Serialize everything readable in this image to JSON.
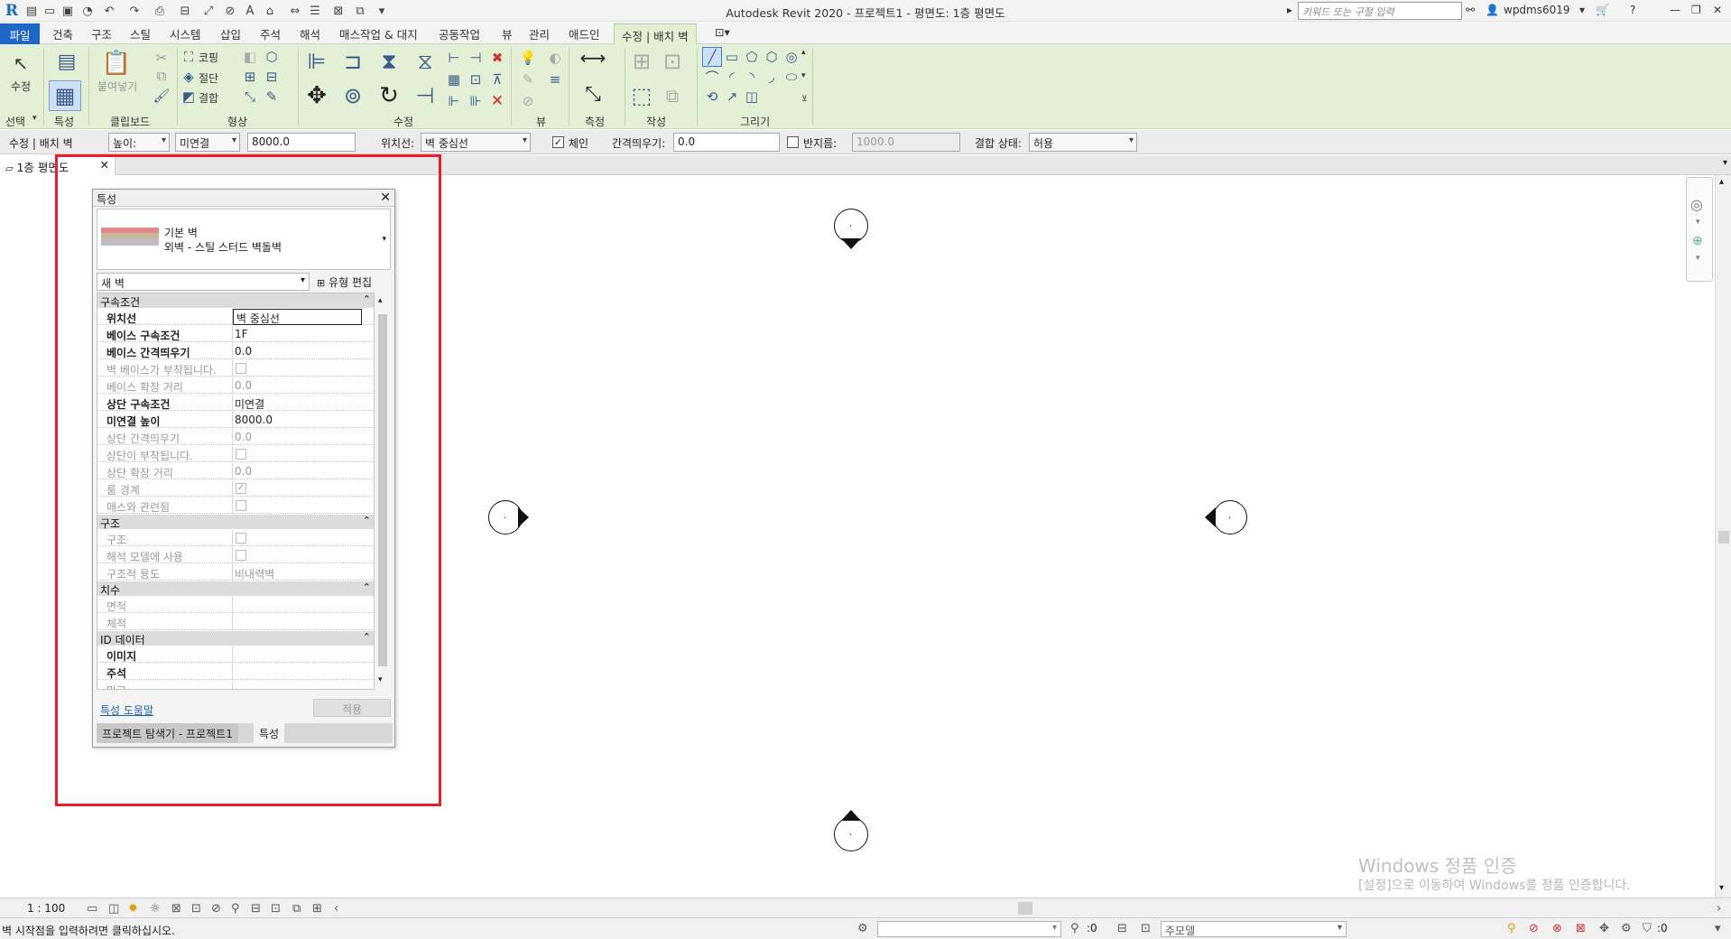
{
  "window": {
    "title": "Autodesk Revit 2020 - 프로젝트1 - 평면도: 1층 평면도",
    "search_placeholder": "키워드 또는 구절 입력",
    "user": "wpdms6019"
  },
  "ribbon": {
    "tabs": [
      "파일",
      "건축",
      "구조",
      "스틸",
      "시스템",
      "삽입",
      "주석",
      "해석",
      "매스작업 & 대지",
      "공동작업",
      "뷰",
      "관리",
      "애드인",
      "수정 | 배치 벽"
    ],
    "panels": {
      "select_label": "선택",
      "properties_label": "특성",
      "clipboard_label": "클립보드",
      "geometry_label": "형상",
      "modify_label": "수정",
      "view_label": "뷰",
      "measure_label": "측정",
      "create_label": "작성",
      "draw_label": "그리기",
      "modify_button": "수정",
      "paste_button": "붙여넣기",
      "cope_button": "코핑",
      "cut_button": "절단",
      "join_button": "결합"
    }
  },
  "options_bar": {
    "context": "수정 | 배치 벽",
    "height_select": "높이:",
    "top_constraint": "미연결",
    "height_value": "8000.0",
    "location_label": "위치선:",
    "location_value": "벽 중심선",
    "chain_label": "체인",
    "chain_checked": true,
    "offset_label": "간격띄우기:",
    "offset_value": "0.0",
    "radius_label": "반지름:",
    "radius_value": "1000.0",
    "join_status_label": "결합 상태:",
    "join_status_value": "허용"
  },
  "view_tab": {
    "label": "1층 평면도"
  },
  "properties": {
    "title": "특성",
    "family": "기본 벽",
    "type": "외벽 - 스틸 스터드 벽돌벽",
    "instance_filter": "새 벽",
    "edit_type": "유형 편집",
    "groups": [
      {
        "name": "구속조건",
        "rows": [
          {
            "label": "위치선",
            "value": "벽 중심선",
            "kind": "text",
            "dim": false,
            "active": true
          },
          {
            "label": "베이스 구속조건",
            "value": "1F",
            "kind": "text",
            "dim": false
          },
          {
            "label": "베이스 간격띄우기",
            "value": "0.0",
            "kind": "text",
            "dim": false
          },
          {
            "label": "벽 베이스가 부착됩니다.",
            "value": "",
            "kind": "check",
            "checked": false,
            "dim": true
          },
          {
            "label": "베이스 확장 거리",
            "value": "0.0",
            "kind": "text",
            "dim": true
          },
          {
            "label": "상단 구속조건",
            "value": "미연결",
            "kind": "text",
            "dim": false
          },
          {
            "label": "미연결 높이",
            "value": "8000.0",
            "kind": "text",
            "dim": false
          },
          {
            "label": "상단 간격띄우기",
            "value": "0.0",
            "kind": "text",
            "dim": true
          },
          {
            "label": "상단이 부착됩니다.",
            "value": "",
            "kind": "check",
            "checked": false,
            "dim": true
          },
          {
            "label": "상단 확장 거리",
            "value": "0.0",
            "kind": "text",
            "dim": true
          },
          {
            "label": "룸 경계",
            "value": "",
            "kind": "check",
            "checked": true,
            "dim": true
          },
          {
            "label": "매스와 관련됨",
            "value": "",
            "kind": "check",
            "checked": false,
            "dim": true
          }
        ]
      },
      {
        "name": "구조",
        "rows": [
          {
            "label": "구조",
            "value": "",
            "kind": "check",
            "checked": false,
            "dim": true
          },
          {
            "label": "해석 모델에 사용",
            "value": "",
            "kind": "check",
            "checked": false,
            "dim": true
          },
          {
            "label": "구조적 용도",
            "value": "비내력벽",
            "kind": "text",
            "dim": true
          }
        ]
      },
      {
        "name": "치수",
        "rows": [
          {
            "label": "면적",
            "value": "",
            "kind": "text",
            "dim": true
          },
          {
            "label": "체적",
            "value": "",
            "kind": "text",
            "dim": true
          }
        ]
      },
      {
        "name": "ID 데이터",
        "rows": [
          {
            "label": "이미지",
            "value": "",
            "kind": "text",
            "dim": false
          },
          {
            "label": "주석",
            "value": "",
            "kind": "text",
            "dim": false
          },
          {
            "label": "마크",
            "value": "",
            "kind": "text",
            "dim": true
          }
        ]
      }
    ],
    "help_link": "특성 도움말",
    "apply_button": "적용",
    "bottom_tabs": [
      "프로젝트 탐색기 - 프로젝트1",
      "특성"
    ]
  },
  "watermark": {
    "line1": "Windows 정품 인증",
    "line2": "[설정]으로 이동하여 Windows를 정품 인증합니다."
  },
  "view_control": {
    "scale": "1 : 100"
  },
  "status": {
    "message": "벽 시작점을 입력하려면 클릭하십시오.",
    "workset_count": ":0",
    "model": "주모델",
    "filter_count": ":0"
  },
  "colors": {
    "ribbon_bg": "#e4f0d6",
    "file_tab": "#1e66c7",
    "highlight": "#e81e2a"
  }
}
